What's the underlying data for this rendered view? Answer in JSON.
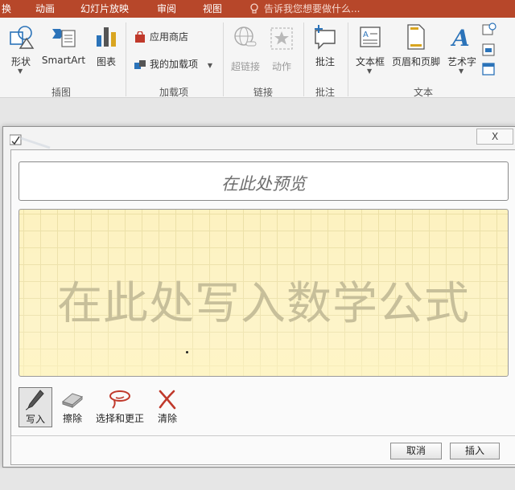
{
  "ribbon_tabs": [
    {
      "label": "换"
    },
    {
      "label": "动画"
    },
    {
      "label": "幻灯片放映"
    },
    {
      "label": "审阅"
    },
    {
      "label": "视图"
    }
  ],
  "tell_me": {
    "placeholder": "告诉我您想要做什么..."
  },
  "ribbon": {
    "shapes": "形状",
    "smartart": "SmartArt",
    "chart": "图表",
    "app_store": "应用商店",
    "my_addins": "我的加载项",
    "hyperlink": "超链接",
    "action": "动作",
    "comment": "批注",
    "textbox": "文本框",
    "header_footer": "页眉和页脚",
    "wordart": "艺术字",
    "groups": {
      "illustrations": "插图",
      "addins": "加载项",
      "links": "链接",
      "comments": "批注",
      "text": "文本"
    }
  },
  "dialog": {
    "close_glyph": "X",
    "preview_text": "在此处预览",
    "writing_placeholder": "在此处写入数学公式",
    "tools": {
      "write": "写入",
      "erase": "擦除",
      "select_correct": "选择和更正",
      "clear": "清除"
    },
    "cancel": "取消",
    "insert": "插入"
  },
  "colors": {
    "tab_bar": "#b7472a",
    "writing_area": "#fdf2c0",
    "icon_blue": "#2b73b9",
    "clear_red": "#c0392b"
  }
}
